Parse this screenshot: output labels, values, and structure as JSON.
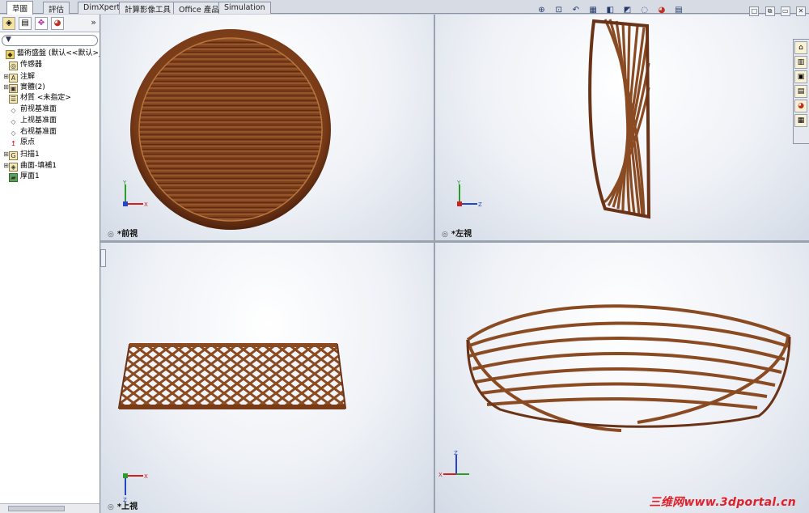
{
  "tabs": [
    "草圖",
    "評估",
    "DimXpert",
    "計算影像工具",
    "Office 產品",
    "Simulation"
  ],
  "feature_tree": {
    "more_glyph": "»",
    "root": "藝術盛盤 (默认<<默认>_",
    "items": [
      {
        "label": "传感器",
        "expand": "",
        "icon": "sensor-icon"
      },
      {
        "label": "注解",
        "expand": "⊞",
        "icon": "annotation-icon"
      },
      {
        "label": "實體(2)",
        "expand": "⊞",
        "icon": "solid-bodies-icon"
      },
      {
        "label": "材質 <未指定>",
        "expand": "",
        "icon": "material-icon"
      },
      {
        "label": "前视基准面",
        "expand": "",
        "icon": "plane-icon"
      },
      {
        "label": "上视基准面",
        "expand": "",
        "icon": "plane-icon"
      },
      {
        "label": "右视基准面",
        "expand": "",
        "icon": "plane-icon"
      },
      {
        "label": "原点",
        "expand": "",
        "icon": "origin-icon"
      },
      {
        "label": "扫描1",
        "expand": "⊞",
        "icon": "sweep-icon"
      },
      {
        "label": "曲面-填補1",
        "expand": "⊞",
        "icon": "surface-fill-icon"
      },
      {
        "label": "厚面1",
        "expand": "",
        "icon": "thicken-icon"
      }
    ]
  },
  "viewports": {
    "front": "*前視",
    "left": "*左視",
    "top": "*上視",
    "iso": ""
  },
  "axes": {
    "x": "X",
    "y": "Y",
    "z": "Z"
  },
  "colors": {
    "wood_dark": "#5a2a12",
    "wood_mid": "#8a4a22",
    "wood_light": "#b9773e",
    "accent_watermark": "#e0202a"
  },
  "watermark": "三维网www.3dportal.cn"
}
